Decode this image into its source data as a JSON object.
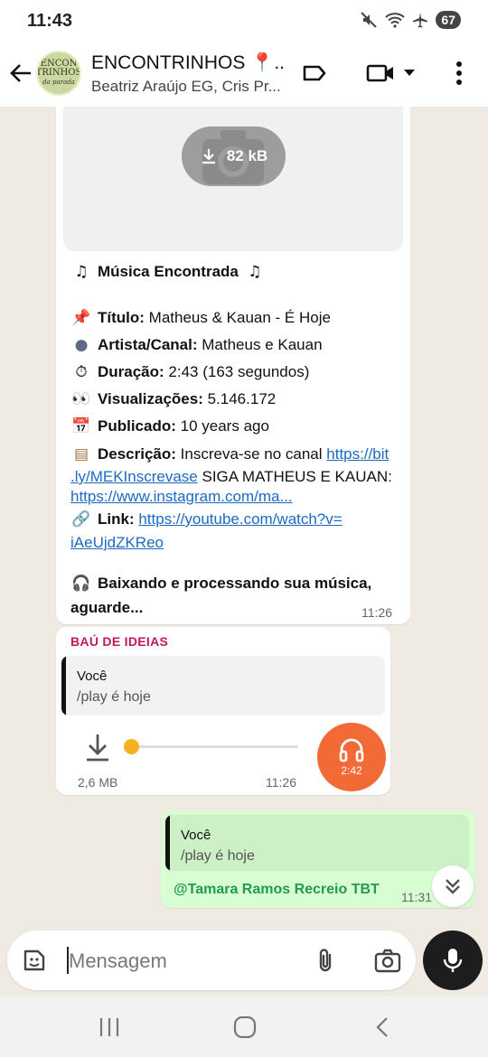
{
  "status": {
    "time": "11:43",
    "battery": "67"
  },
  "header": {
    "group_name": "ENCONTRINHOS 📍...",
    "members": "Beatriz Araújo EG, Cris Pr...",
    "avatar_text_line1": "ENCON",
    "avatar_text_line2": "TRINHOS",
    "avatar_text_line3": "da parada"
  },
  "image_message": {
    "download_size": "82 kB"
  },
  "bot_message": {
    "title_line": "Música Encontrada",
    "titulo_label": "Título:",
    "titulo_value": "Matheus & Kauan - É Hoje",
    "artista_label": "Artista/Canal:",
    "artista_value": "Matheus e Kauan",
    "duracao_label": "Duração:",
    "duracao_value": "2:43 (163 segundos)",
    "views_label": "Visualizações:",
    "views_value": "5.146.172",
    "publicado_label": "Publicado:",
    "publicado_value": "10 years ago",
    "descricao_label": "Descrição:",
    "descricao_value": "Inscreva-se no canal",
    "descricao_link1a": "https://bit",
    "descricao_link1b": ".ly/MEKInscrevase",
    "descricao_cont": "SIGA MATHEUS E KAUAN:",
    "descricao_link2": "https://www.instagram.com/ma...",
    "link_label": "Link:",
    "link_value_a": "https://youtube.com/watch?v=",
    "link_value_b": "iAeUjdZKReo",
    "processing_line1": "Baixando e processando sua música,",
    "processing_line2": "aguarde...",
    "time": "11:26"
  },
  "audio_message": {
    "sender": "BAÚ DE IDEIAS",
    "quote_name": "Você",
    "quote_text": "/play é hoje",
    "size": "2,6 MB",
    "duration": "2:42",
    "time": "11:26",
    "progress": 0
  },
  "own_message": {
    "quote_name": "Você",
    "quote_text": "/play é hoje",
    "mention": "@Tamara Ramos Recreio TBT",
    "time": "11:31"
  },
  "composer": {
    "placeholder": "Mensagem"
  },
  "colors": {
    "chat_bg": "#efeae2",
    "own_bubble": "#d9fdd3",
    "sender_name": "#c2185b",
    "link": "#1c6ac2",
    "play_button": "#f26a36",
    "mention": "#1f9b55"
  },
  "icons": [
    "back-arrow-icon",
    "label-icon",
    "video-call-icon",
    "chevron-down-icon",
    "more-vert-icon",
    "camera-icon",
    "download-icon",
    "headphones-icon",
    "double-chevron-down-icon",
    "sticker-icon",
    "attach-icon",
    "mic-icon"
  ]
}
